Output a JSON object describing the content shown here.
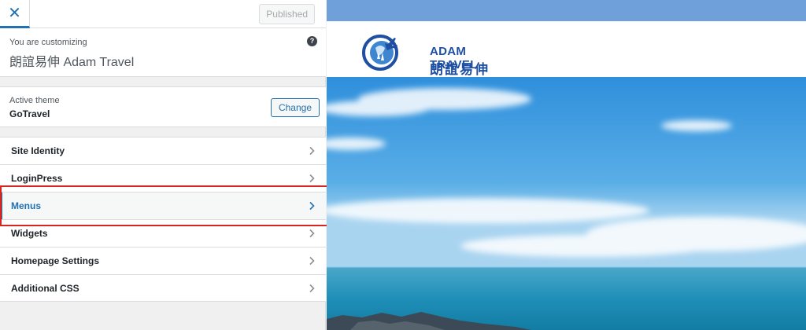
{
  "topbar": {
    "close_glyph": "✕",
    "published_label": "Published"
  },
  "customizing": {
    "label": "You are customizing",
    "site_name": "朗誼易伸 Adam Travel",
    "help_glyph": "?"
  },
  "theme": {
    "label": "Active theme",
    "name": "GoTravel",
    "change_label": "Change"
  },
  "sections": [
    {
      "label": "Site Identity"
    },
    {
      "label": "LoginPress"
    },
    {
      "label": "Menus",
      "active": true
    },
    {
      "label": "Widgets"
    },
    {
      "label": "Homepage Settings"
    },
    {
      "label": "Additional CSS"
    }
  ],
  "preview": {
    "logo_en": "ADAM TRAVEL",
    "logo_zh": "朗誼易伸",
    "colors": {
      "strip": "#6fa0da",
      "brand": "#1e4fa3",
      "sky": "#2f8fdc",
      "sea": "#1f8fb8"
    }
  }
}
